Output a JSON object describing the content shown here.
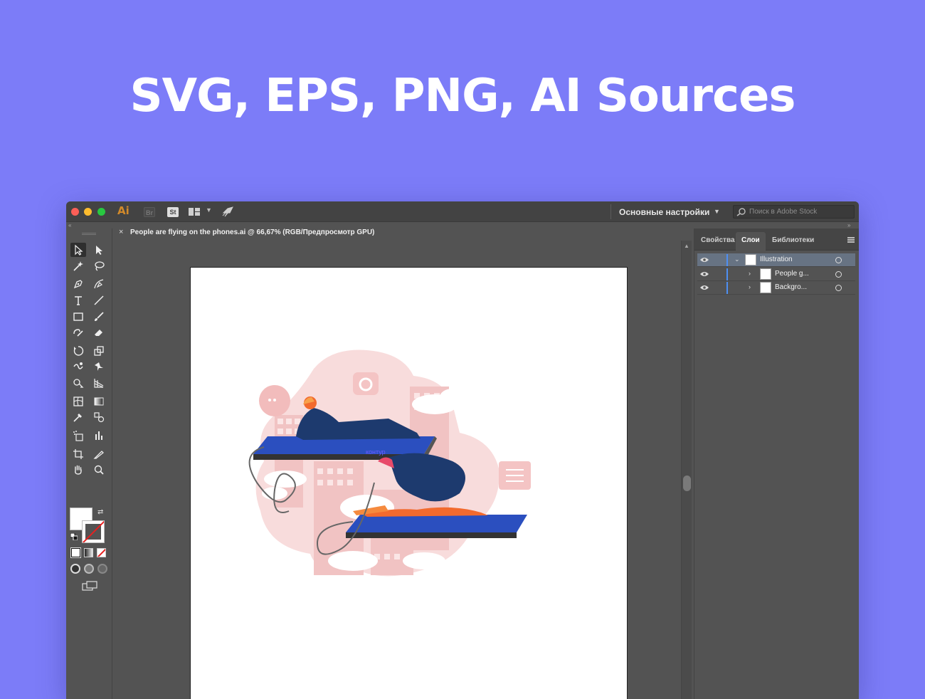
{
  "headline": "SVG, EPS, PNG, AI Sources",
  "app": {
    "logo": "Ai",
    "bridge": "Br",
    "stock": "St",
    "workspace": "Основные настройки",
    "search_placeholder": "Поиск в Adobe Stock"
  },
  "document": {
    "tab_title": "People are flying on the phones.ai @ 66,67% (RGB/Предпросмотр GPU)",
    "close": "×"
  },
  "panel": {
    "tabs": [
      "Свойства",
      "Слои",
      "Библиотеки"
    ],
    "active_tab": "Слои",
    "layers": [
      {
        "name": "Illustration",
        "expanded": true,
        "selected": true
      },
      {
        "name": "People g...",
        "expanded": false,
        "selected": false
      },
      {
        "name": "Backgro...",
        "expanded": false,
        "selected": false
      }
    ]
  },
  "illustration": {
    "path_label": "контур"
  },
  "colors": {
    "background": "#7c7cf8",
    "ui_dark": "#535353",
    "layer_accent": "#4e8ff3",
    "pink": "#f4cfcf",
    "navy": "#1d3a6e",
    "orange": "#f26a2e"
  }
}
